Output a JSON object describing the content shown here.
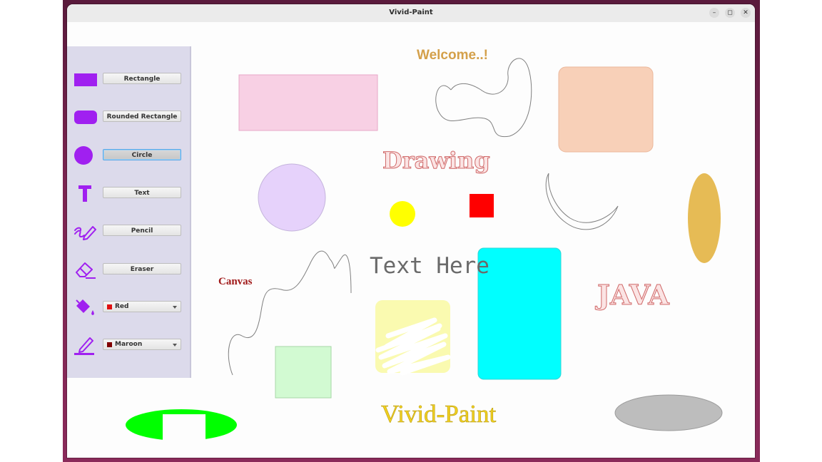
{
  "window": {
    "title": "Vivid-Paint"
  },
  "titlebar_controls": {
    "minimize": "–",
    "maximize": "◻",
    "close": "✕"
  },
  "toolbar": {
    "tools": [
      {
        "label": "Rectangle",
        "icon": "rectangle-icon"
      },
      {
        "label": "Rounded Rectangle",
        "icon": "rounded-rectangle-icon"
      },
      {
        "label": "Circle",
        "icon": "circle-icon",
        "active": true
      },
      {
        "label": "Text",
        "icon": "text-tool-icon"
      },
      {
        "label": "Pencil",
        "icon": "pencil-icon"
      },
      {
        "label": "Eraser",
        "icon": "eraser-icon"
      }
    ],
    "fill_color": {
      "label": "Red",
      "swatch": "#e01010",
      "icon": "paint-bucket-icon"
    },
    "stroke_color": {
      "label": "Maroon",
      "swatch": "#800000",
      "icon": "pen-color-icon"
    },
    "accent": "#a020f0"
  },
  "canvas": {
    "texts": {
      "welcome": "Welcome..!",
      "drawing": "Drawing",
      "text_here": "Text Here",
      "canvas": "Canvas",
      "java": "JAVA",
      "vivid_paint": "Vivid-Paint"
    },
    "colors": {
      "pink_rect": "#f8d0e4",
      "peach_rect": "#f8d0b8",
      "lavender_circle": "#e6d2fb",
      "yellow_circle": "#ffff00",
      "red_square": "#ff0000",
      "cyan_rect": "#00ffff",
      "mustard_ellipse": "#e6bb55",
      "mint_square": "#d2fad2",
      "pale_yellow_rect": "#fafab0",
      "green_ellipse": "#00ff00",
      "gray_ellipse": "#bdbdbd",
      "welcome_text": "#d4a04a",
      "drawing_text": "#e89898",
      "java_text": "#e89898",
      "canvas_text": "#a01818",
      "vivid_text": "#f0d020"
    }
  }
}
